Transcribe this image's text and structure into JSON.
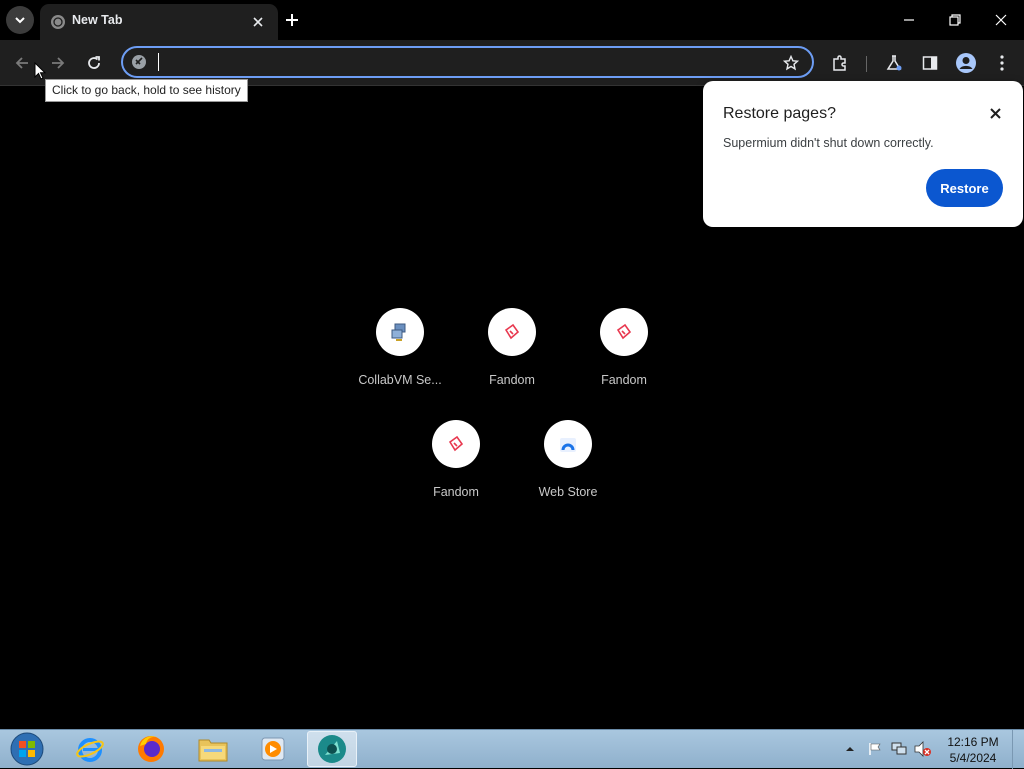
{
  "browser": {
    "tab": {
      "title": "New Tab"
    },
    "omnibox": {
      "value": "",
      "placeholder": ""
    },
    "tooltip": "Click to go back, hold to see history"
  },
  "restore_popup": {
    "title": "Restore pages?",
    "message": "Supermium didn't shut down correctly.",
    "button": "Restore"
  },
  "shortcuts": [
    {
      "label": "CollabVM Se...",
      "icon": "collabvm-icon"
    },
    {
      "label": "Fandom",
      "icon": "fandom-icon"
    },
    {
      "label": "Fandom",
      "icon": "fandom-icon"
    },
    {
      "label": "Fandom",
      "icon": "fandom-icon"
    },
    {
      "label": "Web Store",
      "icon": "web-store-icon"
    }
  ],
  "taskbar": {
    "apps": [
      "internet-explorer-icon",
      "firefox-icon",
      "file-explorer-icon",
      "media-player-icon",
      "supermium-icon"
    ],
    "clock": {
      "time": "12:16 PM",
      "date": "5/4/2024"
    }
  },
  "colors": {
    "accent": "#0b57d0",
    "omnibox_border": "#6d9df4",
    "fandom": "#e8384f"
  }
}
